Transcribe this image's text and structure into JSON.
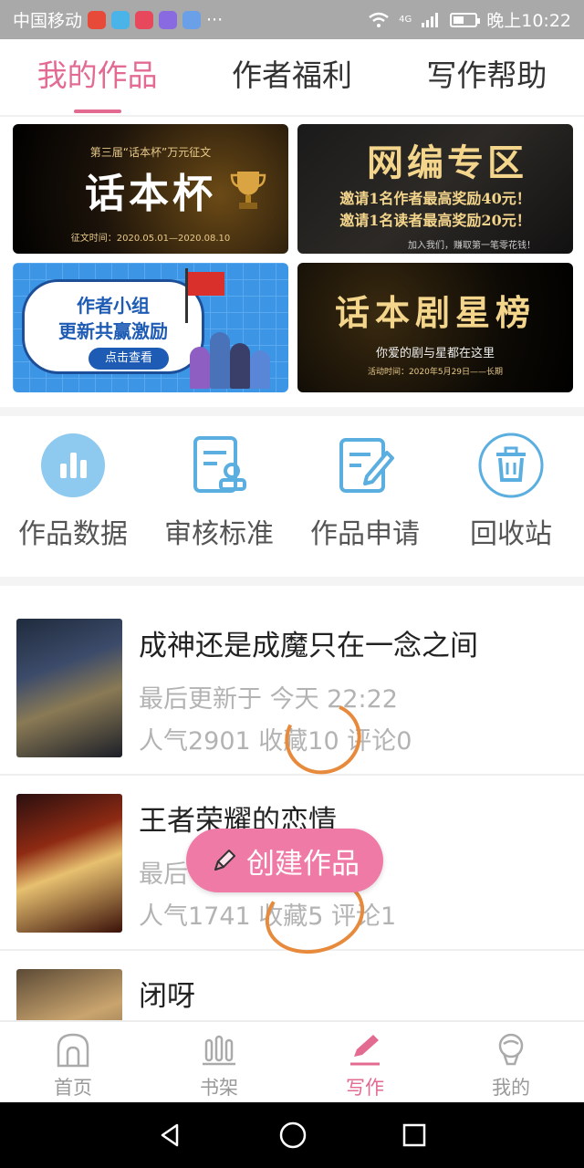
{
  "status_bar": {
    "carrier": "中国移动",
    "more": "···",
    "network": "4G",
    "time": "晚上10:22"
  },
  "top_tabs": [
    {
      "label": "我的作品",
      "active": true
    },
    {
      "label": "作者福利",
      "active": false
    },
    {
      "label": "写作帮助",
      "active": false
    }
  ],
  "banners": {
    "b1": {
      "top": "第三届“话本杯”万元征文",
      "main": "话本杯",
      "bottom": "征文时间：2020.05.01—2020.08.10"
    },
    "b2": {
      "main": "网编专区",
      "line1": "邀请1名作者最高奖励40元！",
      "line2": "邀请1名读者最高奖励20元！",
      "bottom": "加入我们，赚取第一笔零花钱！"
    },
    "b3": {
      "line1": "作者小组",
      "line2": "更新共赢激励",
      "button": "点击查看"
    },
    "b4": {
      "main": "话本剧星榜",
      "line1": "你爱的剧与星都在这里",
      "bottom": "活动时间：2020年5月29日——长期"
    }
  },
  "tools": [
    {
      "label": "作品数据",
      "icon": "bar-chart-icon"
    },
    {
      "label": "审核标准",
      "icon": "review-document-icon"
    },
    {
      "label": "作品申请",
      "icon": "edit-document-icon"
    },
    {
      "label": "回收站",
      "icon": "trash-icon"
    }
  ],
  "works": [
    {
      "title": "成神还是成魔只在一念之间",
      "meta": "最后更新于 今天 22:22",
      "stats": "人气2901 收藏10 评论0"
    },
    {
      "title": "王者荣耀的恋情",
      "meta": "最后",
      "stats": "人气1741 收藏5 评论1"
    },
    {
      "title": "闭呀",
      "meta": "",
      "stats": ""
    }
  ],
  "fab": {
    "label": "创建作品"
  },
  "bottom_nav": [
    {
      "label": "首页",
      "icon": "home-icon",
      "active": false
    },
    {
      "label": "书架",
      "icon": "bookshelf-icon",
      "active": false
    },
    {
      "label": "写作",
      "icon": "pen-icon",
      "active": true
    },
    {
      "label": "我的",
      "icon": "profile-icon",
      "active": false
    }
  ],
  "colors": {
    "accent": "#e36b92",
    "fab": "#ef7aa6",
    "tool_icon": "#5aaee0",
    "annotation_circle": "#e88a3c"
  }
}
